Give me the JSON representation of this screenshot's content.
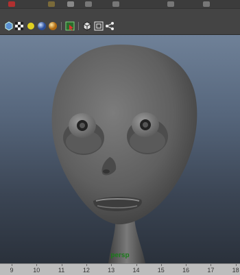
{
  "window": {
    "title": ""
  },
  "viewport": {
    "camera_label": "persp",
    "background_top": "#6f8198",
    "background_bottom": "#2a313b",
    "model_color": "#6b6b6b"
  },
  "view_toolbar": {
    "icons": [
      "wireframe-cube-icon",
      "checker-icon",
      "yellow-light-icon",
      "blue-sphere-icon",
      "orange-sphere-icon",
      "select-mask-icon",
      "cube-icon",
      "frame-icon",
      "graph-icon"
    ]
  },
  "timeline": {
    "ticks": [
      "9",
      "10",
      "11",
      "12",
      "13",
      "14",
      "15",
      "16",
      "17",
      "18"
    ]
  }
}
